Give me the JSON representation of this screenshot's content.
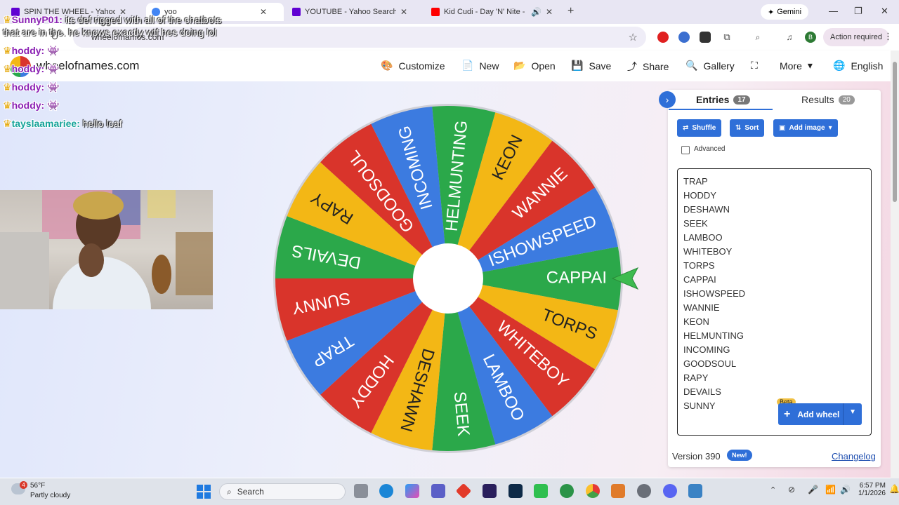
{
  "browser": {
    "tabs": [
      {
        "title": "SPIN THE WHEEL - Yahoo Search",
        "favicon_color": "#6001d2",
        "active": false
      },
      {
        "title": "yoo",
        "favicon_color": "#4285f4",
        "active": true
      },
      {
        "title": "YOUTUBE - Yahoo Search Results",
        "favicon_color": "#6001d2",
        "active": false
      },
      {
        "title": "Kid Cudi - Day 'N' Nite - Yo",
        "favicon_color": "#ff0000",
        "active": false
      }
    ],
    "new_tab_icon": "+",
    "gemini_label": "Gemini",
    "url": "wheelofnames.com",
    "action_required": "Action required"
  },
  "site": {
    "brand": "wheelofnames.com",
    "menu": [
      {
        "icon": "palette-icon",
        "glyph": "🎨",
        "label": "Customize"
      },
      {
        "icon": "file-icon",
        "glyph": "📄",
        "label": "New"
      },
      {
        "icon": "folder-icon",
        "glyph": "📂",
        "label": "Open"
      },
      {
        "icon": "save-icon",
        "glyph": "💾",
        "label": "Save"
      },
      {
        "icon": "share-icon",
        "glyph": "⤴",
        "label": "Share"
      },
      {
        "icon": "search-icon",
        "glyph": "🔍",
        "label": "Gallery"
      },
      {
        "icon": "fullscreen-icon",
        "glyph": "⛶",
        "label": ""
      },
      {
        "icon": "chevron-down-icon",
        "glyph": "▾",
        "label": "More"
      },
      {
        "icon": "globe-icon",
        "glyph": "🌐",
        "label": "English"
      }
    ]
  },
  "wheel": {
    "segments": [
      "CAPPAI",
      "TORPS",
      "WHITEBOY",
      "LAMBOO",
      "SEEK",
      "DESHAWN",
      "HODDY",
      "TRAP",
      "SUNNY",
      "DEVAILS",
      "RAPY",
      "GOODSOUL",
      "INCOMING",
      "HELMUNTING",
      "KEON",
      "WANNIE",
      "ISHOWSPEED"
    ],
    "colors": [
      "#2ba84a",
      "#f3b715",
      "#d9342b",
      "#3c7be0",
      "#2ba84a",
      "#f3b715",
      "#d9342b",
      "#3c7be0",
      "#d9342b",
      "#2ba84a",
      "#f3b715",
      "#d9342b",
      "#3c7be0",
      "#2ba84a",
      "#f3b715",
      "#d9342b",
      "#3c7be0"
    ]
  },
  "panel": {
    "collapse_icon": "›",
    "entries_tab": {
      "label": "Entries",
      "count": "17"
    },
    "results_tab": {
      "label": "Results",
      "count": "20"
    },
    "shuffle": "Shuffle",
    "sort": "Sort",
    "add_image": "Add image",
    "advanced": "Advanced",
    "entries": [
      "TRAP",
      "HODDY",
      "DESHAWN",
      "SEEK",
      "LAMBOO",
      "WHITEBOY",
      "TORPS",
      "CAPPAI",
      "ISHOWSPEED",
      "WANNIE",
      "KEON",
      "HELMUNTING",
      "INCOMING",
      "GOODSOUL",
      "RAPY",
      "DEVAILS",
      "SUNNY"
    ],
    "beta": "Beta",
    "add_wheel": "Add wheel",
    "version": "Version 390",
    "new_badge": "New!",
    "changelog": "Changelog"
  },
  "overlay": {
    "chat": [
      {
        "user": "SunnyP01:",
        "msg": "its def rigged with all of the chatbots"
      },
      {
        "user": "",
        "msg": "that are in the. he knows exactly wtf hes doing lol"
      },
      {
        "user": "hoddy:",
        "msg": ""
      },
      {
        "user": "hoddy:",
        "msg": ""
      },
      {
        "user": "hoddy:",
        "msg": ""
      },
      {
        "user": "hoddy:",
        "msg": ""
      },
      {
        "user": "tayslaamariee:",
        "msg": "hello loaf"
      }
    ]
  },
  "taskbar": {
    "temp": "56°F",
    "weather": "Partly cloudy",
    "weather_badge": "4",
    "search_placeholder": "Search",
    "time": "6:57 PM",
    "date": "1/1/2026"
  }
}
